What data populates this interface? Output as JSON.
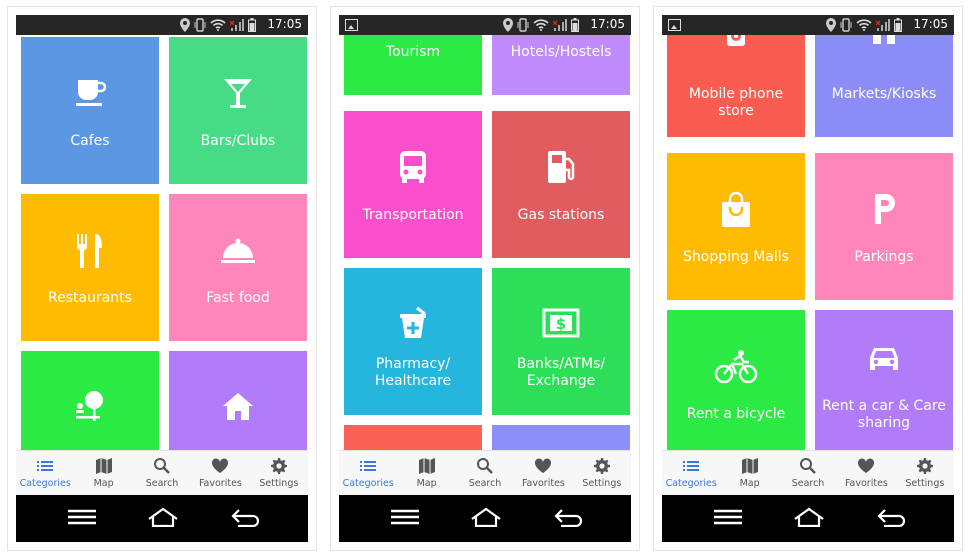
{
  "status": {
    "time": "17:05"
  },
  "tabs": [
    {
      "label": "Categories",
      "icon": "list-icon"
    },
    {
      "label": "Map",
      "icon": "map-icon"
    },
    {
      "label": "Search",
      "icon": "search-icon"
    },
    {
      "label": "Favorites",
      "icon": "heart-icon"
    },
    {
      "label": "Settings",
      "icon": "gear-icon"
    }
  ],
  "screens": [
    {
      "tiles": [
        {
          "label": "Cafes",
          "color": "#5b97e2",
          "icon": "coffee-cup-icon"
        },
        {
          "label": "Bars/Clubs",
          "color": "#46dc86",
          "icon": "cocktail-glass-icon"
        },
        {
          "label": "Restaurants",
          "color": "#ffbb02",
          "icon": "fork-knife-icon"
        },
        {
          "label": "Fast food",
          "color": "#ff86b8",
          "icon": "cloche-icon"
        },
        {
          "label": "",
          "color": "#2bea44",
          "icon": "park-tree-icon"
        },
        {
          "label": "",
          "color": "#b07cf7",
          "icon": "house-icon"
        }
      ]
    },
    {
      "tiles": [
        {
          "label": "Tourism",
          "color": "#2bea44",
          "icon": ""
        },
        {
          "label": "Hotels/Hostels",
          "color": "#c08bfc",
          "icon": ""
        },
        {
          "label": "Transportation",
          "color": "#f94fcc",
          "icon": "bus-icon"
        },
        {
          "label": "Gas stations",
          "color": "#e05c5f",
          "icon": "fuel-pump-icon"
        },
        {
          "label": "Pharmacy/\nHealthcare",
          "color": "#25b6dd",
          "icon": "mortar-plus-icon"
        },
        {
          "label": "Banks/ATMs/\nExchange",
          "color": "#2dde58",
          "icon": "cash-dollar-icon"
        },
        {
          "label": "",
          "color": "#fa6157",
          "icon": ""
        },
        {
          "label": "",
          "color": "#8b8ff7",
          "icon": ""
        }
      ]
    },
    {
      "tiles": [
        {
          "label": "Mobile phone store",
          "color": "#fa5c52",
          "icon": "phone-gear-icon"
        },
        {
          "label": "Markets/Kiosks",
          "color": "#8b8cf6",
          "icon": "kiosk-icon"
        },
        {
          "label": "Shopping Malls",
          "color": "#ffbb02",
          "icon": "shopping-bag-icon"
        },
        {
          "label": "Parkings",
          "color": "#ff86b8",
          "icon": "parking-p-icon"
        },
        {
          "label": "Rent a bicycle",
          "color": "#2bea44",
          "icon": "bicycle-rider-icon"
        },
        {
          "label": "Rent a car & Care\nsharing",
          "color": "#b07cf7",
          "icon": "car-icon"
        }
      ]
    }
  ]
}
